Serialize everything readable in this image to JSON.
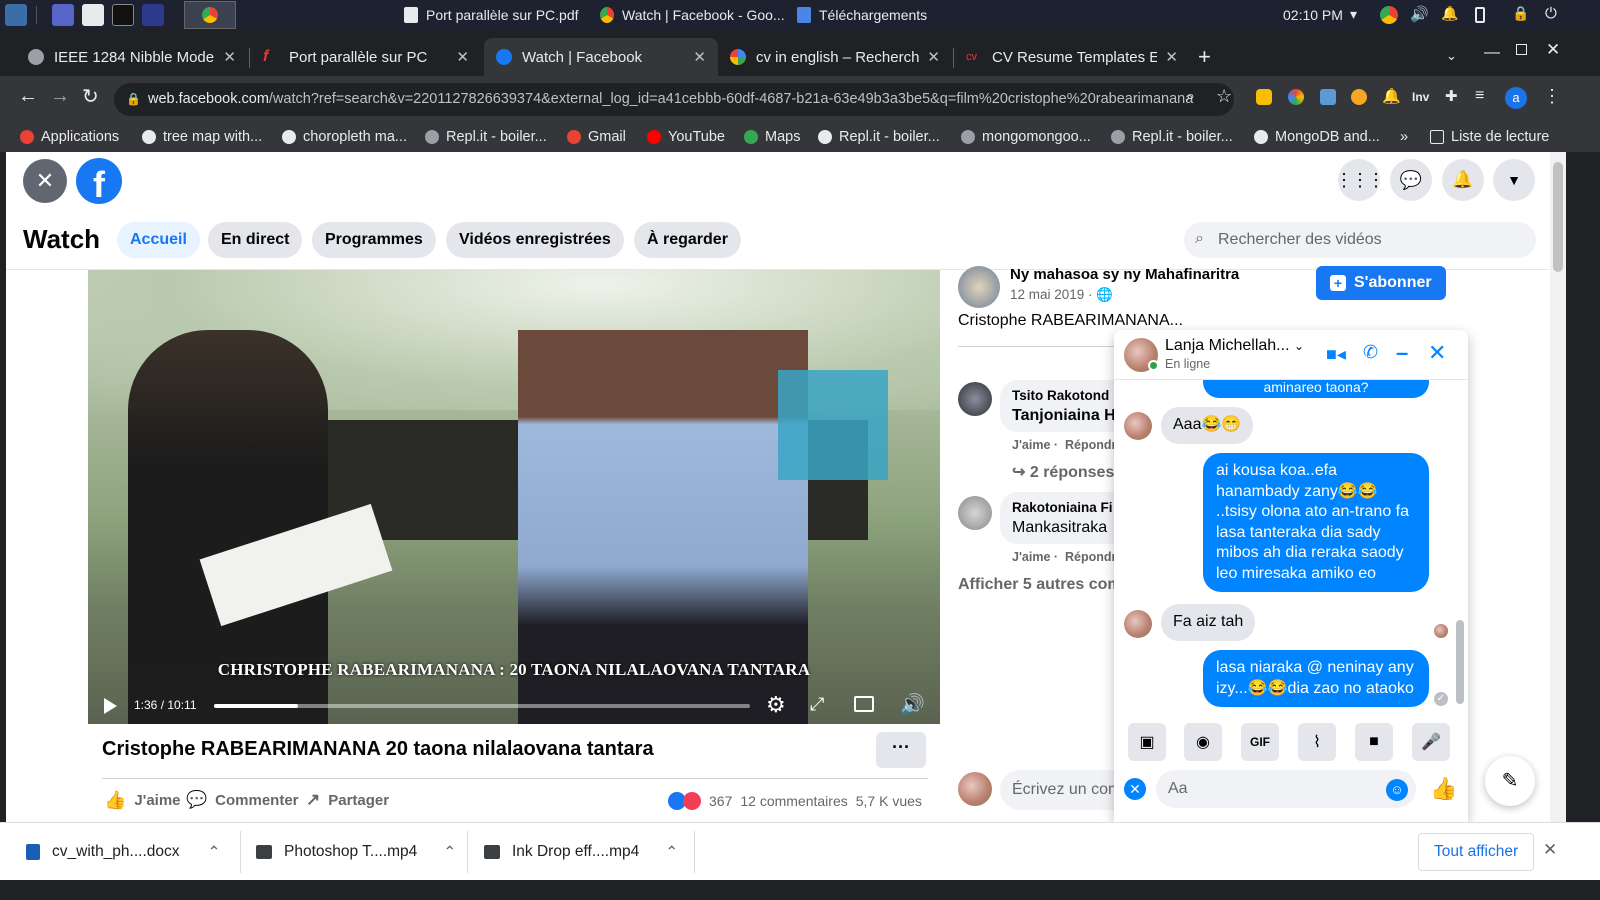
{
  "taskbar": {
    "apps": [
      {
        "label": "Port parallèle sur PC.pdf",
        "icon": "document-icon"
      },
      {
        "label": "Watch | Facebook - Goo...",
        "icon": "chrome-icon"
      },
      {
        "label": "Téléchargements",
        "icon": "folder-icon"
      }
    ],
    "clock": "02:10 PM"
  },
  "browser": {
    "tabs": [
      {
        "label": "IEEE 1284 Nibble Mode",
        "icon": "globe-icon",
        "color": "#9aa0a6"
      },
      {
        "label": "Port parallèle sur PC",
        "icon": "f-logo-icon",
        "color": "#e53935"
      },
      {
        "label": "Watch | Facebook",
        "icon": "facebook-icon",
        "color": "#1877f2",
        "active": true
      },
      {
        "label": "cv in english – Recherche",
        "icon": "google-icon",
        "color": "#4285f4"
      },
      {
        "label": "CV Resume Templates Exa",
        "icon": "cv-icon",
        "color": "#e53935"
      }
    ],
    "url_host": "web.facebook.com",
    "url_path": "/watch?ref=search&v=2201127826639374&external_log_id=a41cebbb-60df-4687-b21a-63e49b3a3be5&q=film%20cristophe%20rabearimanana",
    "profile_letter": "a",
    "inv_label": "Inv",
    "bookmarks": [
      {
        "label": "Applications",
        "icon": "apps-grid-icon",
        "color": "#ea4335"
      },
      {
        "label": "tree map with...",
        "icon": "bookmark-icon",
        "color": "#e8eaed"
      },
      {
        "label": "choropleth ma...",
        "icon": "bookmark-icon",
        "color": "#e8eaed"
      },
      {
        "label": "Repl.it - boiler...",
        "icon": "replit-icon",
        "color": "#9aa0a6"
      },
      {
        "label": "Gmail",
        "icon": "gmail-icon",
        "color": "#ea4335"
      },
      {
        "label": "YouTube",
        "icon": "youtube-icon",
        "color": "#ff0000"
      },
      {
        "label": "Maps",
        "icon": "maps-icon",
        "color": "#34a853"
      },
      {
        "label": "Repl.it - boiler...",
        "icon": "replit-icon",
        "color": "#e8eaed"
      },
      {
        "label": "mongomongoo...",
        "icon": "globe-icon",
        "color": "#9aa0a6"
      },
      {
        "label": "Repl.it - boiler...",
        "icon": "replit-icon",
        "color": "#9aa0a6"
      },
      {
        "label": "MongoDB and...",
        "icon": "mongodb-icon",
        "color": "#e8eaed"
      }
    ],
    "bookmarks_more": "»",
    "reading_list": "Liste de lecture"
  },
  "watch": {
    "title": "Watch",
    "tabs": [
      "Accueil",
      "En direct",
      "Programmes",
      "Vidéos enregistrées",
      "À regarder"
    ],
    "search_placeholder": "Rechercher des vidéos"
  },
  "video": {
    "caption": "CHRISTOPHE RABEARIMANANA : 20 TAONA NILALAOVANA TANTARA",
    "time": "1:36 / 10:11",
    "progress": 0.157,
    "title": "Cristophe RABEARIMANANA 20 taona nilalaovana tantara",
    "more": "···",
    "like": "J'aime",
    "comment": "Commenter",
    "share": "Partager",
    "reactions": "367",
    "comments_count": "12 commentaires",
    "views": "5,7 K vues"
  },
  "post": {
    "page_name": "Ny mahasoa sy ny Mahafinaritra",
    "date": "12 mai 2019 · ",
    "subscribe": "S'abonner",
    "text": "Cristophe RABEARIMANANA...",
    "comments": [
      {
        "author": "Tsito Rakotond",
        "text": "Tanjoniaina H",
        "like": "J'aime",
        "reply": "Répondr",
        "replies": "2 réponses"
      },
      {
        "author": "Rakotoniaina Fi",
        "text": "Mankasitraka",
        "like": "J'aime",
        "reply": "Répondr"
      }
    ],
    "more_comments": "Afficher 5 autres com",
    "write_placeholder": "Écrivez un com"
  },
  "chat": {
    "name": "Lanja Michellah...",
    "status": "En ligne",
    "partial_top": "aminareo taona?",
    "messages": [
      {
        "dir": "in",
        "text": "Aaa😂😁"
      },
      {
        "dir": "out",
        "text": "ai kousa koa..efa hanambady zany😂😂 ..tsisy olona ato an-trano fa lasa tanteraka dia sady mibos ah  dia reraka saody leo miresaka amiko eo"
      },
      {
        "dir": "in",
        "text": "Fa aiz tah"
      },
      {
        "dir": "out",
        "text": "lasa niaraka @ neninay any izy...😂😂dia zao no ataoko"
      }
    ],
    "input_placeholder": "Aa",
    "gif_label": "GIF"
  },
  "downloads": {
    "items": [
      {
        "name": "cv_with_ph....docx",
        "icon": "docx-icon",
        "color": "#1a5fb4"
      },
      {
        "name": "Photoshop T....mp4",
        "icon": "video-file-icon",
        "color": "#3c4043"
      },
      {
        "name": "Ink Drop eff....mp4",
        "icon": "video-file-icon",
        "color": "#3c4043"
      }
    ],
    "show_all": "Tout afficher"
  },
  "colors": {
    "facebook_blue": "#1877f2",
    "messenger_blue": "#0084ff",
    "chrome_dark": "#202124",
    "online_green": "#31a24c"
  }
}
